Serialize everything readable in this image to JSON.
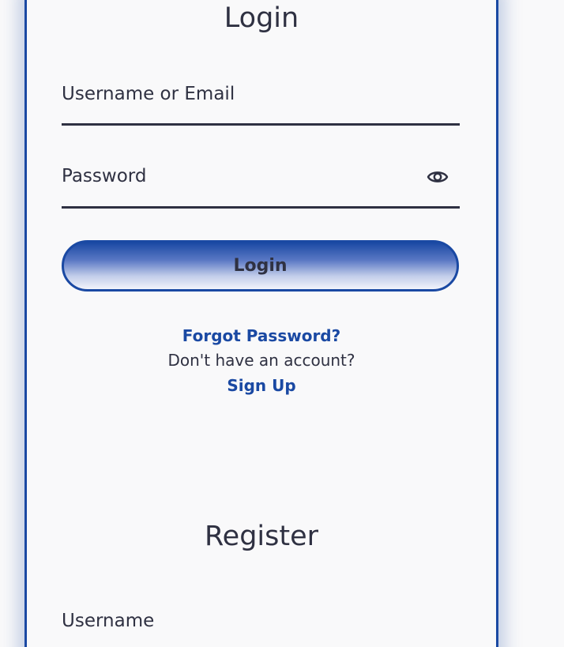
{
  "login": {
    "title": "Login",
    "username_label": "Username or Email",
    "password_label": "Password",
    "submit_label": "Login",
    "forgot_password": "Forgot Password?",
    "no_account_text": "Don't have an account?",
    "signup_link": "Sign Up"
  },
  "register": {
    "title": "Register",
    "username_label": "Username"
  },
  "icons": {
    "password_toggle": "eye-icon"
  },
  "colors": {
    "accent": "#1a49a3",
    "text": "#2f3142",
    "background": "#f9f9fa"
  }
}
